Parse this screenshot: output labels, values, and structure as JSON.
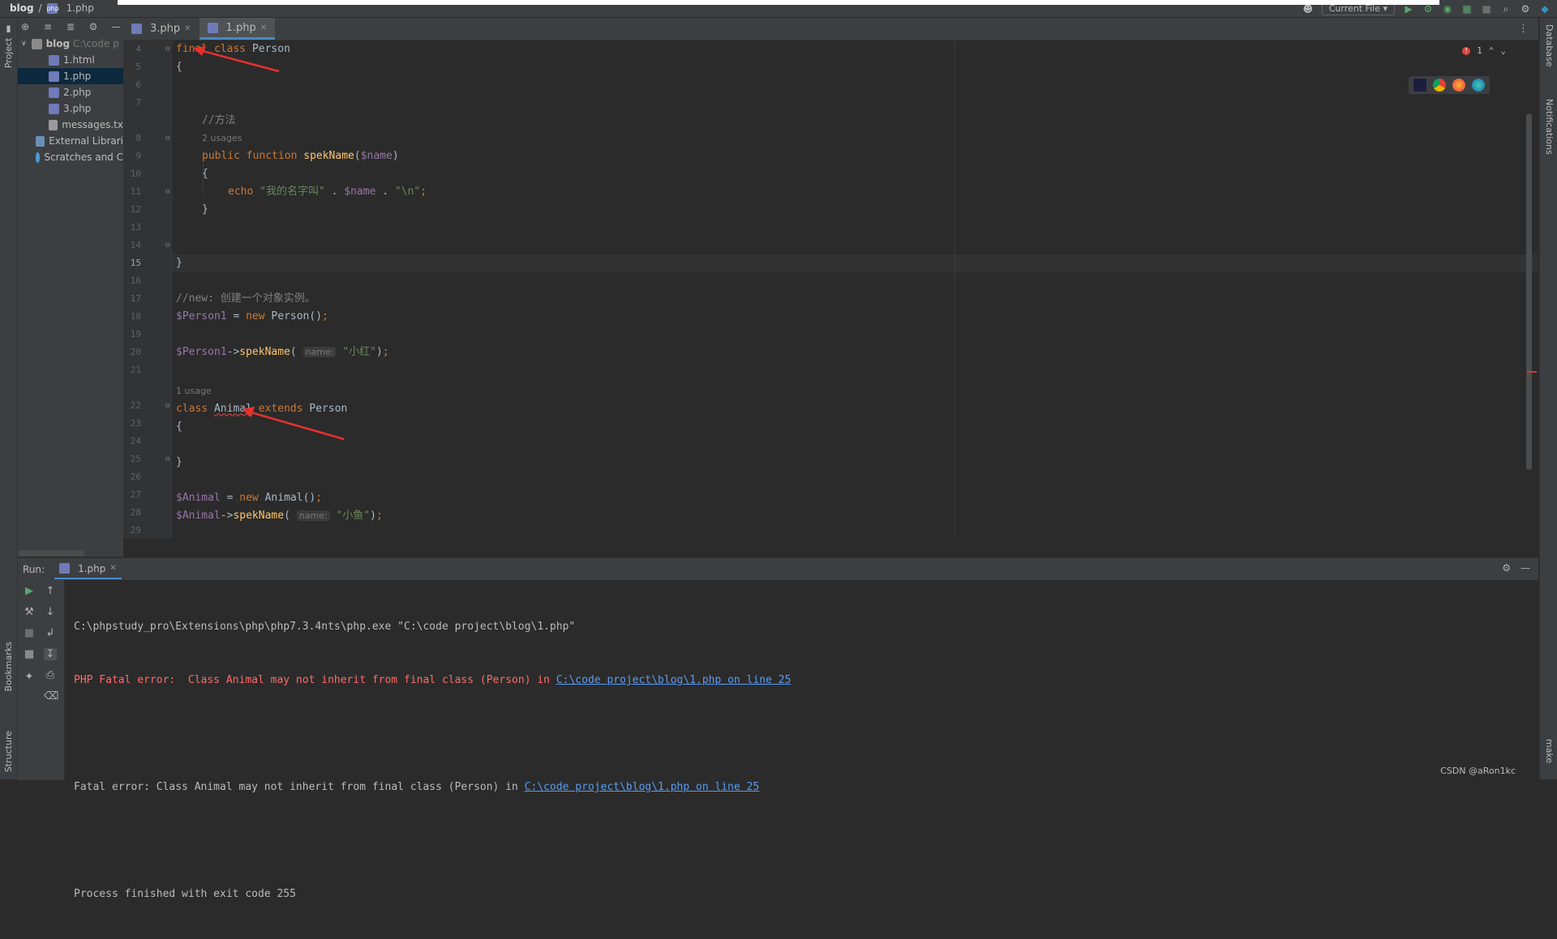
{
  "titlebar": {
    "project": "blog",
    "file": "1.php",
    "run_config": "Current File"
  },
  "project_panel": {
    "label": "Project",
    "tree": [
      {
        "label": "blog",
        "path": "C:\\code p",
        "type": "folder"
      },
      {
        "label": "1.html",
        "type": "file"
      },
      {
        "label": "1.php",
        "type": "file",
        "selected": true
      },
      {
        "label": "2.php",
        "type": "file"
      },
      {
        "label": "3.php",
        "type": "file"
      },
      {
        "label": "messages.tx",
        "type": "file"
      },
      {
        "label": "External Librari",
        "type": "lib"
      },
      {
        "label": "Scratches and C",
        "type": "scratch"
      }
    ]
  },
  "editor": {
    "tabs": [
      {
        "label": "3.php",
        "active": false
      },
      {
        "label": "1.php",
        "active": true
      }
    ],
    "error_count": "1",
    "hints": {
      "usages_2": "2 usages",
      "usages_1": "1 usage",
      "param_name": "name:"
    },
    "line_numbers": [
      "4",
      "5",
      "6",
      "7",
      "8",
      "9",
      "10",
      "11",
      "12",
      "13",
      "14",
      "15",
      "16",
      "17",
      "18",
      "19",
      "20",
      "21",
      "22",
      "23",
      "24",
      "25",
      "26",
      "27",
      "28",
      "29"
    ],
    "code": {
      "l4_kw1": "final",
      "l4_kw2": "class",
      "l4_name": "Person",
      "brace_open": "{",
      "brace_close": "}",
      "l7_comment": "//方法",
      "l8_kw1": "public",
      "l8_kw2": "function",
      "l8_fn": "spekName",
      "l8_param": "$name",
      "l10_echo": "echo",
      "l10_str": "\"我的名字叫\"",
      "l10_dot": " . ",
      "l10_var": "$name",
      "l10_nl": "\"\\n\"",
      "l16_comment": "//new: 创建一个对象实例。",
      "l17_var": "$Person1",
      "l17_new": "new",
      "l17_cls": "Person",
      "l19_var": "$Person1",
      "l19_call": "spekName",
      "l19_arg": "\"小红\"",
      "l22_kw1": "class",
      "l22_name": "Animal",
      "l22_kw2": "extends",
      "l22_parent": "Person",
      "l27_var": "$Animal",
      "l27_new": "new",
      "l27_cls": "Animal",
      "l28_var": "$Animal",
      "l28_call": "spekName",
      "l28_arg": "\"小鱼\""
    }
  },
  "run_panel": {
    "label": "Run:",
    "tab": "1.php",
    "lines": {
      "cmd": "C:\\phpstudy_pro\\Extensions\\php\\php7.3.4nts\\php.exe \"C:\\code project\\blog\\1.php\"",
      "err1_text": "PHP Fatal error:  Class Animal may not inherit from final class (Person) in ",
      "err1_link": "C:\\code project\\blog\\1.php on line 25",
      "err2_text": "Fatal error: Class Animal may not inherit from final class (Person) in ",
      "err2_link": "C:\\code project\\blog\\1.php on line 25",
      "exit": "Process finished with exit code 255"
    }
  },
  "side_labels": {
    "bookmarks": "Bookmarks",
    "structure": "Structure",
    "database": "Database",
    "notifications": "Notifications",
    "make": "make"
  },
  "watermark": "CSDN @aRon1kc",
  "colors": {
    "keyword": "#cc7832",
    "variable": "#9876aa",
    "function": "#ffc66d",
    "string": "#6a8759",
    "error_text": "#ff6b68",
    "link": "#589df6",
    "annotation_arrow": "#e8312f"
  }
}
